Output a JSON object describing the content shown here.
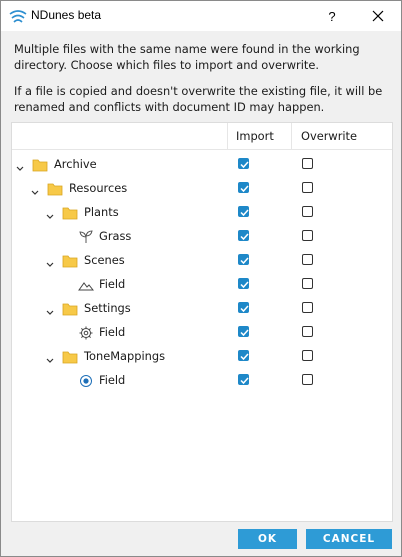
{
  "window": {
    "title": "NDunes beta",
    "help_glyph": "?",
    "close_glyph": "✕"
  },
  "message": {
    "line1": "Multiple files with the same name were found in the working directory. Choose which files to import and overwrite.",
    "line2": "If a file is copied and doesn't overwrite the existing file, it will be renamed and conflicts with document ID may happen."
  },
  "table": {
    "columns": {
      "import": "Import",
      "overwrite": "Overwrite"
    },
    "rows": [
      {
        "label": "Archive",
        "icon": "folder-icon",
        "expanded": true,
        "import": true,
        "overwrite": false
      },
      {
        "label": "Resources",
        "icon": "folder-icon",
        "expanded": true,
        "import": true,
        "overwrite": false
      },
      {
        "label": "Plants",
        "icon": "folder-icon",
        "expanded": true,
        "import": true,
        "overwrite": false
      },
      {
        "label": "Grass",
        "icon": "plant-icon",
        "import": true,
        "overwrite": false
      },
      {
        "label": "Scenes",
        "icon": "folder-icon",
        "expanded": true,
        "import": true,
        "overwrite": false
      },
      {
        "label": "Field",
        "icon": "terrain-icon",
        "import": true,
        "overwrite": false
      },
      {
        "label": "Settings",
        "icon": "folder-icon",
        "expanded": true,
        "import": true,
        "overwrite": false
      },
      {
        "label": "Field",
        "icon": "gear-icon",
        "import": true,
        "overwrite": false
      },
      {
        "label": "ToneMappings",
        "icon": "folder-icon",
        "expanded": true,
        "import": true,
        "overwrite": false
      },
      {
        "label": "Field",
        "icon": "target-icon",
        "import": true,
        "overwrite": false
      }
    ]
  },
  "buttons": {
    "ok": "OK",
    "cancel": "CANCEL"
  },
  "colors": {
    "accent": "#2e9bd6",
    "folder": "#f7c948",
    "check": "#1e88c8"
  }
}
